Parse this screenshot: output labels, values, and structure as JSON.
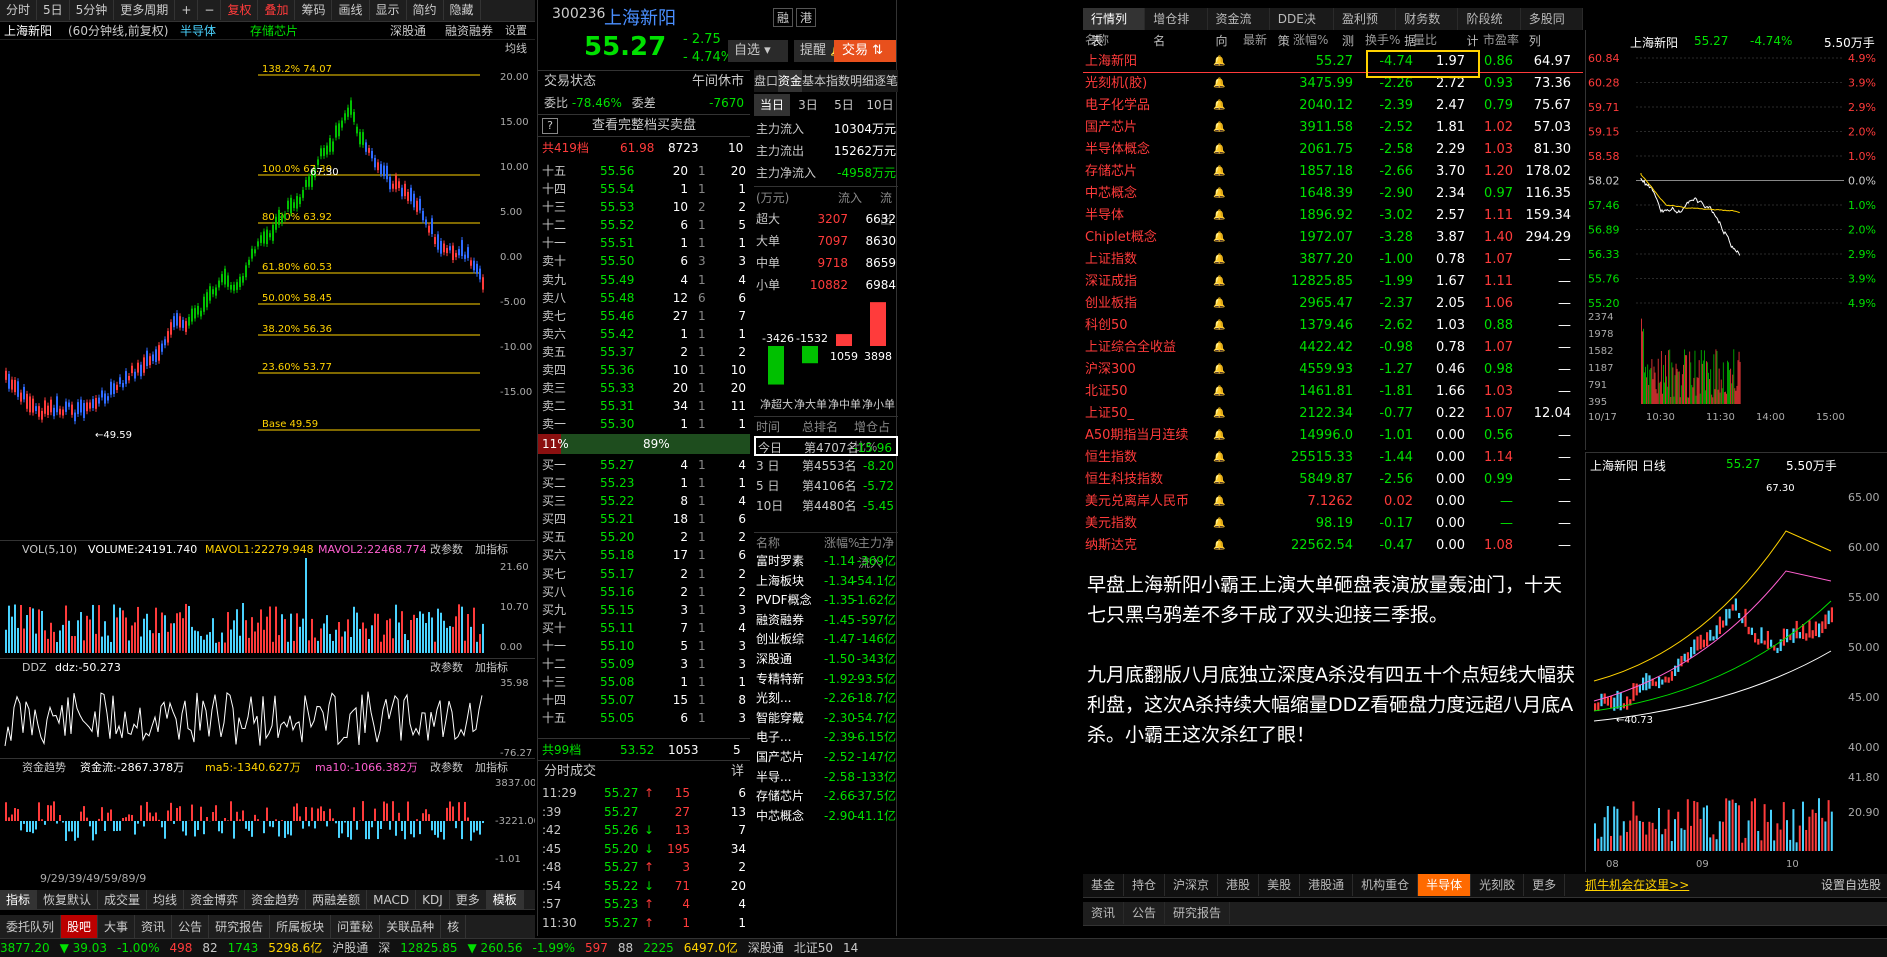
{
  "colors": {
    "up": "#ff3b3b",
    "down": "#00e000",
    "accent": "#ff6a00",
    "fib": "#ffd200"
  },
  "toolbar": {
    "items": [
      "分时",
      "5日",
      "5分钟",
      "更多周期",
      "+",
      "−",
      "复权",
      "叠加",
      "筹码",
      "画线",
      "显示",
      "简约",
      "隐藏"
    ]
  },
  "left": {
    "name": "上海新阳",
    "desc": "(60分钟线,前复权)",
    "tags": [
      "半导体",
      "存储芯片"
    ],
    "right_btns": [
      "深股通",
      "融资融券",
      "设置均线"
    ],
    "fib": [
      {
        "label": "138.2% 74.07"
      },
      {
        "label": "100.0% 67.30"
      },
      {
        "label": "80.90% 63.92"
      },
      {
        "label": "61.80% 60.53"
      },
      {
        "label": "50.00% 58.45"
      },
      {
        "label": "38.20% 56.36"
      },
      {
        "label": "23.60% 53.77"
      },
      {
        "label": "Base   49.59"
      }
    ],
    "hi_label": "67.30",
    "lo_label": "49.59",
    "yaxis": [
      "20.00",
      "15.00",
      "10.00",
      "5.00",
      "0.00",
      "-5.00",
      "-10.00",
      "-15.00"
    ],
    "vol_title": "VOL(5,10)",
    "vol_val": "VOLUME:24191.740",
    "mavol1": "MAVOL1:22279.948",
    "mavol2": "MAVOL2:22468.774",
    "vol_axis": [
      "21.60",
      "10.70",
      "0.00"
    ],
    "ddz_title": "DDZ",
    "ddz_val": "ddz:-50.273",
    "ddz_axis": [
      "35.98",
      "-76.27"
    ],
    "zj_title": "资金趋势",
    "zj_val": "资金流:-2867.378万",
    "zj_ma5": "ma5:-1340.627万",
    "zj_ma10": "ma10:-1066.382万",
    "zj_axis": [
      "3837.00",
      "-3221.00",
      "-1.01"
    ],
    "params": [
      "改参数",
      "加指标",
      "换指标"
    ],
    "dates": "9/29/39/49/59/89/9",
    "bottom_tabs": [
      "指标",
      "恢复默认",
      "成交量",
      "均线",
      "资金博弈",
      "资金趋势",
      "两融差额",
      "MACD",
      "KDJ",
      "更多",
      "模板"
    ],
    "bottom_tabs2": [
      "委托队列",
      "股吧",
      "大事",
      "资讯",
      "公告",
      "研究报告",
      "所属板块",
      "问董秘",
      "关联品种",
      "核"
    ]
  },
  "mid": {
    "code": "300236",
    "name": "上海新阳",
    "price": "55.27",
    "chg": "- 2.75",
    "pct": "- 4.74%",
    "btns": [
      "融",
      "港"
    ],
    "zixuan": "自选",
    "tixing": "提醒",
    "jiaoyi": "交易",
    "status_l": "交易状态",
    "status_r": "午间休市",
    "weibi_l": "委比",
    "weibi": "-78.46%",
    "weicha_l": "委差",
    "weicha": "-7670",
    "full": "查看完整档买卖盘",
    "total_sell": {
      "l": "共419档",
      "p": "61.98",
      "v": "8723",
      "n": "10"
    },
    "sells": [
      [
        "十五",
        "55.56",
        "20",
        "1",
        "20"
      ],
      [
        "十四",
        "55.54",
        "1",
        "1",
        "1"
      ],
      [
        "十三",
        "55.53",
        "10",
        "2",
        "2"
      ],
      [
        "十二",
        "55.52",
        "6",
        "1",
        "5"
      ],
      [
        "十一",
        "55.51",
        "1",
        "1",
        "1"
      ],
      [
        "卖十",
        "55.50",
        "6",
        "3",
        "3"
      ],
      [
        "卖九",
        "55.49",
        "4",
        "1",
        "4"
      ],
      [
        "卖八",
        "55.48",
        "12",
        "6",
        "6"
      ],
      [
        "卖七",
        "55.46",
        "27",
        "1",
        "7"
      ],
      [
        "卖六",
        "55.42",
        "1",
        "1",
        "1"
      ],
      [
        "卖五",
        "55.37",
        "2",
        "1",
        "2"
      ],
      [
        "卖四",
        "55.36",
        "10",
        "1",
        "10"
      ],
      [
        "卖三",
        "55.33",
        "20",
        "1",
        "20"
      ],
      [
        "卖二",
        "55.31",
        "34",
        "1",
        "11"
      ],
      [
        "卖一",
        "55.30",
        "1",
        "1",
        "1"
      ]
    ],
    "ratio_l": "11%",
    "ratio_r": "89%",
    "buys": [
      [
        "买一",
        "55.27",
        "4",
        "1",
        "4"
      ],
      [
        "买二",
        "55.23",
        "1",
        "1",
        "1"
      ],
      [
        "买三",
        "55.22",
        "8",
        "1",
        "4"
      ],
      [
        "买四",
        "55.21",
        "18",
        "1",
        "6"
      ],
      [
        "买五",
        "55.20",
        "2",
        "1",
        "2"
      ],
      [
        "买六",
        "55.18",
        "17",
        "1",
        "6"
      ],
      [
        "买七",
        "55.17",
        "2",
        "1",
        "2"
      ],
      [
        "买八",
        "55.16",
        "2",
        "1",
        "2"
      ],
      [
        "买九",
        "55.15",
        "3",
        "1",
        "3"
      ],
      [
        "买十",
        "55.11",
        "7",
        "1",
        "4"
      ],
      [
        "十一",
        "55.10",
        "5",
        "1",
        "3"
      ],
      [
        "十二",
        "55.09",
        "3",
        "1",
        "3"
      ],
      [
        "十三",
        "55.08",
        "1",
        "1",
        "1"
      ],
      [
        "十四",
        "55.07",
        "15",
        "1",
        "8"
      ],
      [
        "十五",
        "55.05",
        "6",
        "1",
        "3"
      ]
    ],
    "total_buy": {
      "l": "共99档",
      "p": "53.52",
      "v": "1053",
      "n": "5"
    },
    "trade_title": "分时成交",
    "trade_more": "详",
    "trades": [
      [
        "11:29",
        "55.27",
        "↑",
        "15",
        "6"
      ],
      [
        ":39",
        "55.27",
        "",
        "27",
        "13"
      ],
      [
        ":42",
        "55.26",
        "↓",
        "13",
        "7"
      ],
      [
        ":45",
        "55.20",
        "↓",
        "195",
        "34"
      ],
      [
        ":48",
        "55.27",
        "↑",
        "3",
        "2"
      ],
      [
        ":54",
        "55.22",
        "↓",
        "71",
        "20"
      ],
      [
        ":57",
        "55.23",
        "↑",
        "4",
        "4"
      ],
      [
        "11:30",
        "55.27",
        "↑",
        "1",
        "1"
      ]
    ],
    "ftabs": [
      "盘口",
      "资金",
      "基本",
      "指数",
      "明细",
      "逐笔"
    ],
    "dtabs": [
      "当日",
      "3日",
      "5日",
      "10日"
    ],
    "flow": [
      [
        "主力流入",
        "10304万元"
      ],
      [
        "主力流出",
        "15262万元"
      ],
      [
        "主力净流入",
        "-4958万元"
      ]
    ],
    "flow_head": [
      "(万元)",
      "流入",
      "流出"
    ],
    "flow_rows": [
      [
        "超大",
        "3207",
        "6632"
      ],
      [
        "大单",
        "7097",
        "8630"
      ],
      [
        "中单",
        "9718",
        "8659"
      ],
      [
        "小单",
        "10882",
        "6984"
      ]
    ],
    "bars": [
      {
        "l": "净超大",
        "v": -3426
      },
      {
        "l": "净大单",
        "v": -1532
      },
      {
        "l": "净中单",
        "v": 1059
      },
      {
        "l": "净小单",
        "v": 3898
      }
    ],
    "rank_head": [
      "时间",
      "总排名",
      "增仓占比%"
    ],
    "ranks": [
      [
        "今日",
        "第4707名",
        "-15.96"
      ],
      [
        "3 日",
        "第4553名",
        "-8.20"
      ],
      [
        "5 日",
        "第4106名",
        "-5.72"
      ],
      [
        "10日",
        "第4480名",
        "-5.45"
      ]
    ],
    "sect_head": [
      "名称",
      "涨幅%",
      "主力净流入"
    ],
    "sects": [
      [
        "富时罗素",
        "-1.14",
        "-369亿"
      ],
      [
        "上海板块",
        "-1.34",
        "-54.1亿"
      ],
      [
        "PVDF概念",
        "-1.35",
        "-1.62亿"
      ],
      [
        "融资融券",
        "-1.45",
        "-597亿"
      ],
      [
        "创业板综",
        "-1.47",
        "-146亿"
      ],
      [
        "深股通",
        "-1.50",
        "-343亿"
      ],
      [
        "专精特新",
        "-1.92",
        "-93.5亿"
      ],
      [
        "光刻...",
        "-2.26",
        "-18.7亿"
      ],
      [
        "智能穿戴",
        "-2.30",
        "-54.7亿"
      ],
      [
        "电子...",
        "-2.39",
        "-6.15亿"
      ],
      [
        "国产芯片",
        "-2.52",
        "-147亿"
      ],
      [
        "半导...",
        "-2.58",
        "-133亿"
      ],
      [
        "存储芯片",
        "-2.66",
        "-37.5亿"
      ],
      [
        "中芯概念",
        "-2.90",
        "-41.1亿"
      ]
    ]
  },
  "list": {
    "tabs": [
      "行情列表",
      "增仓排名",
      "资金流向",
      "DDE决策",
      "盈利预测",
      "财务数据",
      "阶段统计",
      "多股同列"
    ],
    "head": [
      "名称",
      "最新",
      "涨幅%",
      "换手%",
      "量比",
      "市盈率"
    ],
    "rows": [
      [
        "上海新阳",
        "55.27",
        "-4.74",
        "1.97",
        "0.86",
        "64.97"
      ],
      [
        "光刻机(胶)",
        "3475.99",
        "-2.26",
        "2.72",
        "0.93",
        "73.36"
      ],
      [
        "电子化学品",
        "2040.12",
        "-2.39",
        "2.47",
        "0.79",
        "75.67"
      ],
      [
        "国产芯片",
        "3911.58",
        "-2.52",
        "1.81",
        "1.02",
        "57.03"
      ],
      [
        "半导体概念",
        "2061.75",
        "-2.58",
        "2.29",
        "1.03",
        "81.30"
      ],
      [
        "存储芯片",
        "1857.18",
        "-2.66",
        "3.70",
        "1.20",
        "178.02"
      ],
      [
        "中芯概念",
        "1648.39",
        "-2.90",
        "2.34",
        "0.97",
        "116.35"
      ],
      [
        "半导体",
        "1896.92",
        "-3.02",
        "2.57",
        "1.11",
        "159.34"
      ],
      [
        "Chiplet概念",
        "1972.07",
        "-3.28",
        "3.87",
        "1.40",
        "294.29"
      ],
      [
        "上证指数",
        "3877.20",
        "-1.00",
        "0.78",
        "1.07",
        "—"
      ],
      [
        "深证成指",
        "12825.85",
        "-1.99",
        "1.67",
        "1.11",
        "—"
      ],
      [
        "创业板指",
        "2965.47",
        "-2.37",
        "2.05",
        "1.06",
        "—"
      ],
      [
        "科创50",
        "1379.46",
        "-2.62",
        "1.03",
        "0.88",
        "—"
      ],
      [
        "上证综合全收益",
        "4422.42",
        "-0.98",
        "0.78",
        "1.07",
        "—"
      ],
      [
        "沪深300",
        "4559.93",
        "-1.27",
        "0.46",
        "0.98",
        "—"
      ],
      [
        "北证50",
        "1461.81",
        "-1.81",
        "1.66",
        "1.03",
        "—"
      ],
      [
        "上证50_",
        "2122.34",
        "-0.77",
        "0.22",
        "1.07",
        "12.04"
      ],
      [
        "A50期指当月连续",
        "14996.0",
        "-1.01",
        "0.00",
        "0.56",
        "—"
      ],
      [
        "恒生指数",
        "25515.33",
        "-1.44",
        "0.00",
        "1.14",
        "—"
      ],
      [
        "恒生科技指数",
        "5849.87",
        "-2.56",
        "0.00",
        "0.99",
        "—"
      ],
      [
        "美元兑离岸人民币",
        "7.1262",
        "0.02",
        "0.00",
        "—",
        "—"
      ],
      [
        "美元指数",
        "98.19",
        "-0.17",
        "0.00",
        "—",
        "—"
      ],
      [
        "纳斯达克",
        "22562.54",
        "-0.47",
        "0.00",
        "1.08",
        "—"
      ]
    ],
    "note": "早盘上海新阳小霸王上演大单砸盘表演放量轰油门，十天七只黑乌鸦差不多干成了双头迎接三季报。\n\n九月底翻版八月底独立深度A杀没有四五十个点短线大幅获利盘，这次A杀持续大幅缩量DDZ看砸盘力度远超八月底A杀。小霸王这次杀红了眼！",
    "btabs": [
      "基金",
      "持仓",
      "沪深京",
      "港股",
      "美股",
      "港股通",
      "机构重仓",
      "半导体",
      "光刻胶",
      "更多"
    ],
    "promo": "抓牛机会在这里>>",
    "set_label": "设置自选股",
    "btabs2": [
      "资讯",
      "公告",
      "研究报告"
    ]
  },
  "rt": {
    "name": "上海新阳",
    "price": "55.27",
    "pct": "-4.74%",
    "vol": "5.50万手",
    "left_axis": [
      "60.84",
      "60.28",
      "59.71",
      "59.15",
      "58.58",
      "58.02",
      "57.46",
      "56.89",
      "56.33",
      "55.76",
      "55.20"
    ],
    "right_axis": [
      "4.9%",
      "3.9%",
      "2.9%",
      "2.0%",
      "1.0%",
      "0.0%",
      "1.0%",
      "2.0%",
      "2.9%",
      "3.9%",
      "4.9%"
    ],
    "vol_axis": [
      "2374",
      "1978",
      "1582",
      "1187",
      "791",
      "395"
    ],
    "times": [
      "10/17",
      "10:30",
      "11:30",
      "14:00",
      "15:00"
    ],
    "d_name": "上海新阳 日线",
    "d_price": "55.27",
    "d_vol": "5.50万手",
    "d_hi": "67.30",
    "d_lo": "40.73",
    "d_axis": [
      "65.00",
      "60.00",
      "55.00",
      "50.00",
      "45.00",
      "40.00"
    ],
    "d_vaxis": [
      "41.80",
      "20.90"
    ],
    "d_months": [
      "08",
      "09",
      "10"
    ]
  },
  "status": {
    "items": [
      "3877.20",
      "▼ 39.03",
      "-1.00%",
      "498",
      "82",
      "1743",
      "5298.6亿",
      "沪股通",
      "深",
      "12825.85",
      "▼ 260.56",
      "-1.99%",
      "597",
      "88",
      "2225",
      "6497.0亿",
      "深股通",
      "北证50",
      "14"
    ]
  }
}
